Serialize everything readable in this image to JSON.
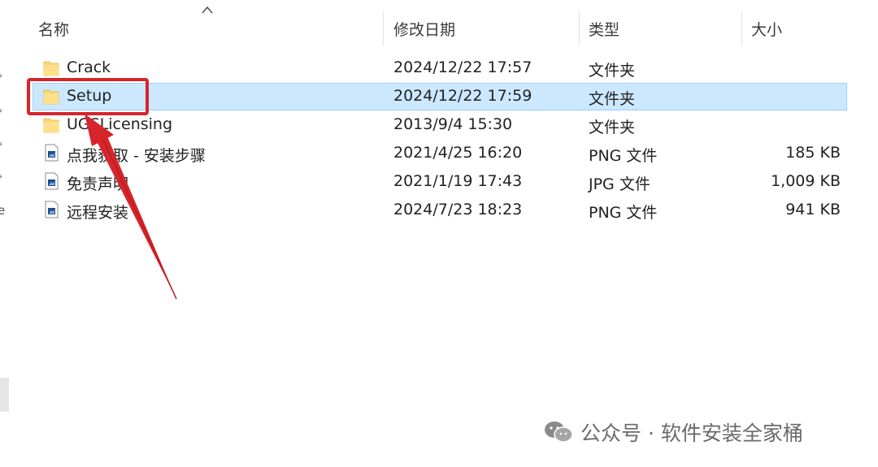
{
  "columns": {
    "name": "名称",
    "modified": "修改日期",
    "type": "类型",
    "size": "大小"
  },
  "files": [
    {
      "name": "Crack",
      "modified": "2024/12/22 17:57",
      "type": "文件夹",
      "size": "",
      "icon": "folder-icon",
      "selected": false
    },
    {
      "name": "Setup",
      "modified": "2024/12/22 17:59",
      "type": "文件夹",
      "size": "",
      "icon": "folder-icon",
      "selected": true
    },
    {
      "name": "UGSLicensing",
      "modified": "2013/9/4 15:30",
      "type": "文件夹",
      "size": "",
      "icon": "folder-icon",
      "selected": false
    },
    {
      "name": "点我获取 - 安装步骤",
      "modified": "2021/4/25 16:20",
      "type": "PNG 文件",
      "size": "185 KB",
      "icon": "image-file-icon",
      "selected": false
    },
    {
      "name": "免责声明",
      "modified": "2021/1/19 17:43",
      "type": "JPG 文件",
      "size": "1,009 KB",
      "icon": "image-file-icon",
      "selected": false
    },
    {
      "name": "远程安装",
      "modified": "2024/7/23 18:23",
      "type": "PNG 文件",
      "size": "941 KB",
      "icon": "image-file-icon",
      "selected": false
    }
  ],
  "watermark": {
    "text": "公众号 · 软件安装全家桶",
    "icon": "wechat-icon"
  },
  "left_strip_letter": "e",
  "colors": {
    "selection_bg": "#cce8ff",
    "selection_border": "#99d1ff",
    "annotation_red": "#d6252b",
    "folder_yellow": "#f8d775"
  }
}
